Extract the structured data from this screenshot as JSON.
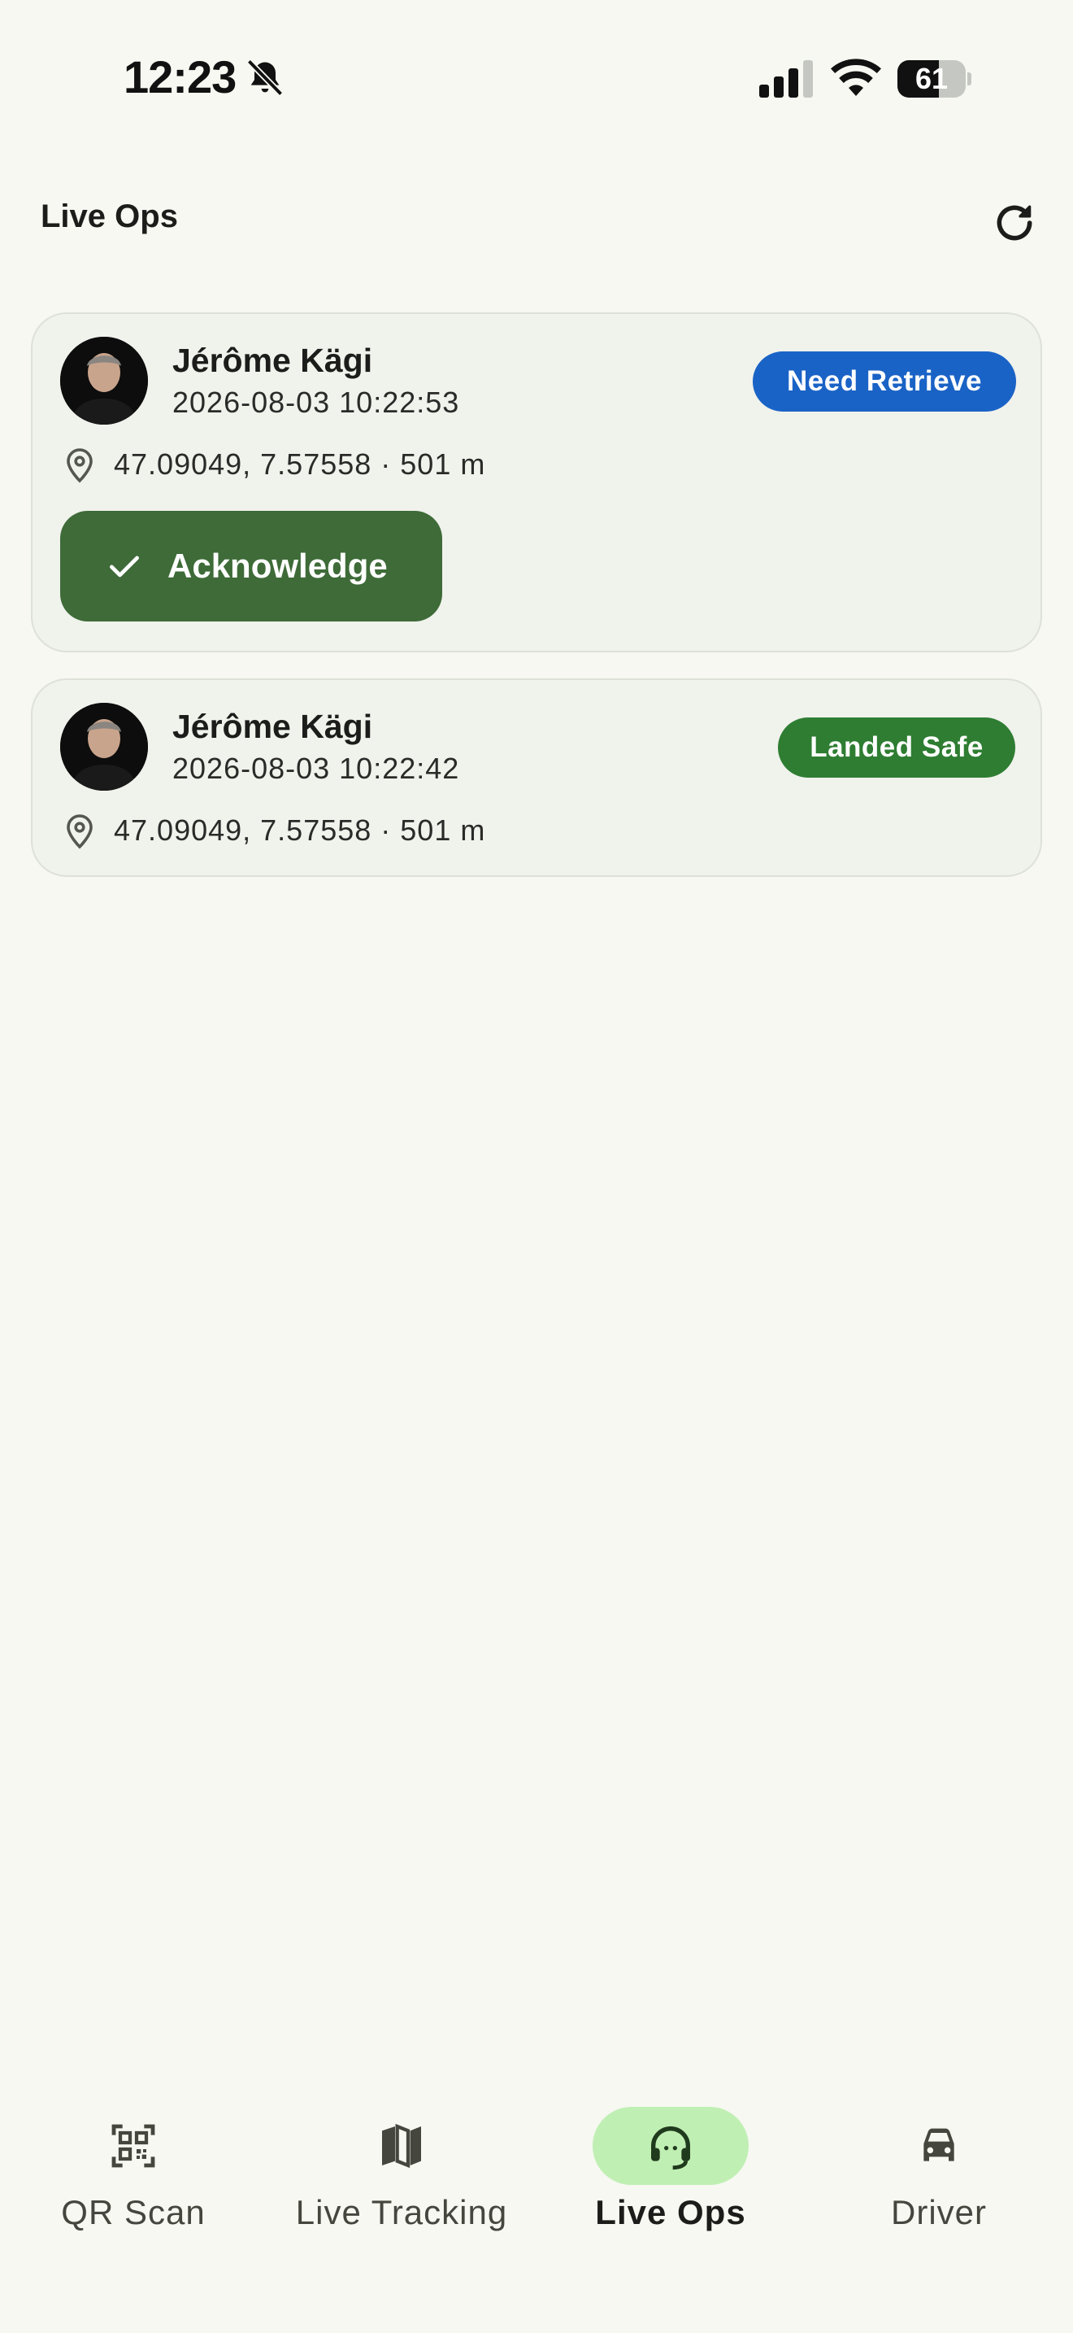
{
  "status_bar": {
    "time": "12:23",
    "battery": "61",
    "battery_level": 0.61
  },
  "app_bar": {
    "title": "Live Ops",
    "refresh_icon": "refresh-icon"
  },
  "cards": [
    {
      "name": "Jérôme Kägi",
      "timestamp": "2026-08-03 10:22:53",
      "status": "Need Retrieve",
      "status_color": "#1a63c6",
      "location": "47.09049, 7.57558 · 501 m",
      "action": "Acknowledge"
    },
    {
      "name": "Jérôme Kägi",
      "timestamp": "2026-08-03 10:22:42",
      "status": "Landed Safe",
      "status_color": "#2e7d32",
      "location": "47.09049, 7.57558 · 501 m"
    }
  ],
  "bottom_nav": {
    "items": [
      {
        "label": "QR Scan",
        "icon": "qr-code-icon"
      },
      {
        "label": "Live Tracking",
        "icon": "map-icon"
      },
      {
        "label": "Live Ops",
        "icon": "headset-icon",
        "active": true
      },
      {
        "label": "Driver",
        "icon": "car-icon"
      }
    ]
  },
  "colors": {
    "background": "#f6f8f1",
    "card": "#f0f2ec",
    "primary_button": "#3e6b38",
    "active_nav_pill": "#c0efb4"
  }
}
